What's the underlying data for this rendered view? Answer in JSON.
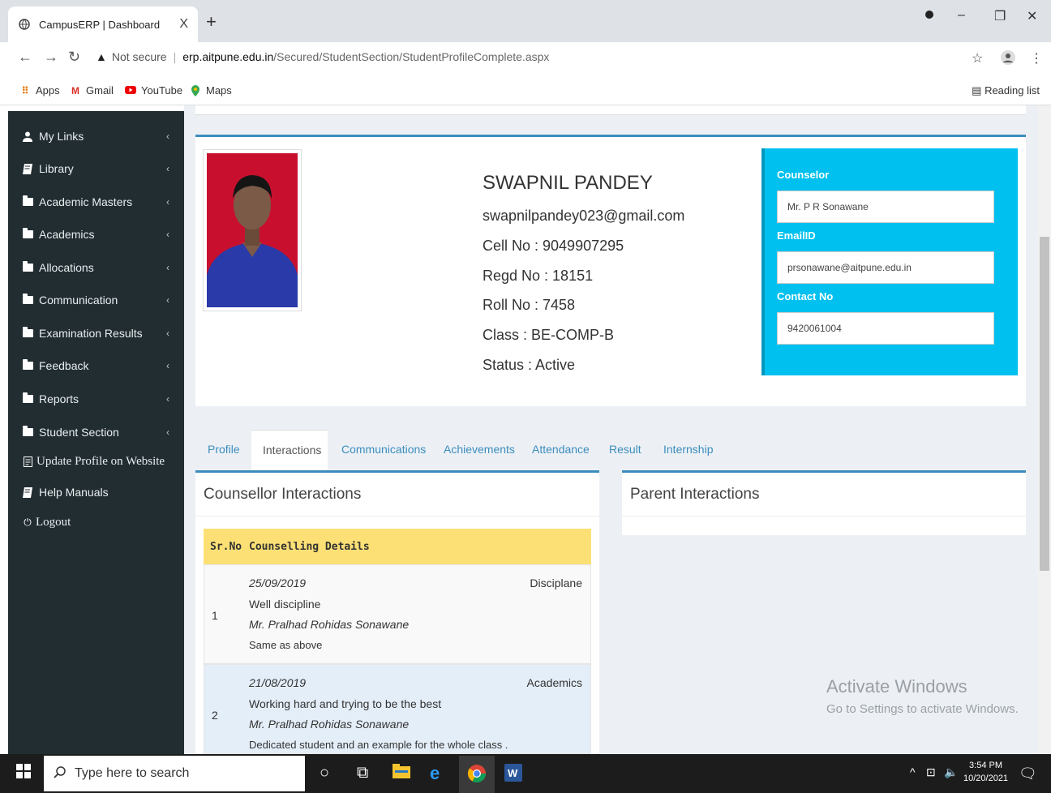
{
  "browser": {
    "tab_title": "CampusERP | Dashboard",
    "tab_close": "X",
    "new_tab": "+",
    "not_secure": "Not secure",
    "url_host": "erp.aitpune.edu.in",
    "url_path": "/Secured/StudentSection/StudentProfileComplete.aspx",
    "bookmarks": [
      "Apps",
      "Gmail",
      "YouTube",
      "Maps"
    ],
    "reading_list": "Reading list"
  },
  "sidebar": {
    "items": [
      {
        "label": "My Links",
        "icon": "user-icon"
      },
      {
        "label": "Library",
        "icon": "book-icon"
      },
      {
        "label": "Academic Masters",
        "icon": "folder-icon"
      },
      {
        "label": "Academics",
        "icon": "folder-icon"
      },
      {
        "label": "Allocations",
        "icon": "folder-icon"
      },
      {
        "label": "Communication",
        "icon": "folder-icon"
      },
      {
        "label": "Examination Results",
        "icon": "folder-icon"
      },
      {
        "label": "Feedback",
        "icon": "folder-icon"
      },
      {
        "label": "Reports",
        "icon": "folder-icon"
      },
      {
        "label": "Student Section",
        "icon": "folder-icon"
      },
      {
        "label": "Update Profile on Website",
        "icon": "document-icon"
      },
      {
        "label": "Help Manuals",
        "icon": "book-icon"
      },
      {
        "label": "Logout",
        "icon": "power-icon"
      }
    ]
  },
  "profile": {
    "name": "SWAPNIL PANDEY",
    "email": "swapnilpandey023@gmail.com",
    "cell": "Cell No : 9049907295",
    "regd": "Regd No : 18151",
    "roll": "Roll No : 7458",
    "class": "Class : BE-COMP-B",
    "status": "Status : Active"
  },
  "counselor": {
    "counselor_label": "Counselor",
    "counselor_value": "Mr.  P R Sonawane",
    "email_label": "EmailID",
    "email_value": "prsonawane@aitpune.edu.in",
    "contact_label": "Contact No",
    "contact_value": "9420061004"
  },
  "tabs": [
    "Profile",
    "Interactions",
    "Communications",
    "Achievements",
    "Attendance",
    "Result",
    "Internship"
  ],
  "counsellor_interactions": {
    "title": "Counsellor Interactions",
    "col_srno": "Sr.No",
    "col_details": "Counselling Details",
    "rows": [
      {
        "srno": "1",
        "date": "25/09/2019",
        "tag": "Disciplane",
        "remark": "Well discipline",
        "by": "Mr. Pralhad Rohidas Sonawane",
        "note": "Same as above"
      },
      {
        "srno": "2",
        "date": "21/08/2019",
        "tag": "Academics",
        "remark": "Working hard and trying to be the best",
        "by": "Mr. Pralhad Rohidas Sonawane",
        "note": "Dedicated student and an example for the whole class ."
      }
    ]
  },
  "parent_interactions": {
    "title": "Parent Interactions"
  },
  "watermark": {
    "line1": "Activate Windows",
    "line2": "Go to Settings to activate Windows."
  },
  "taskbar": {
    "search_placeholder": "Type here to search",
    "time": "3:54 PM",
    "date": "10/20/2021"
  }
}
